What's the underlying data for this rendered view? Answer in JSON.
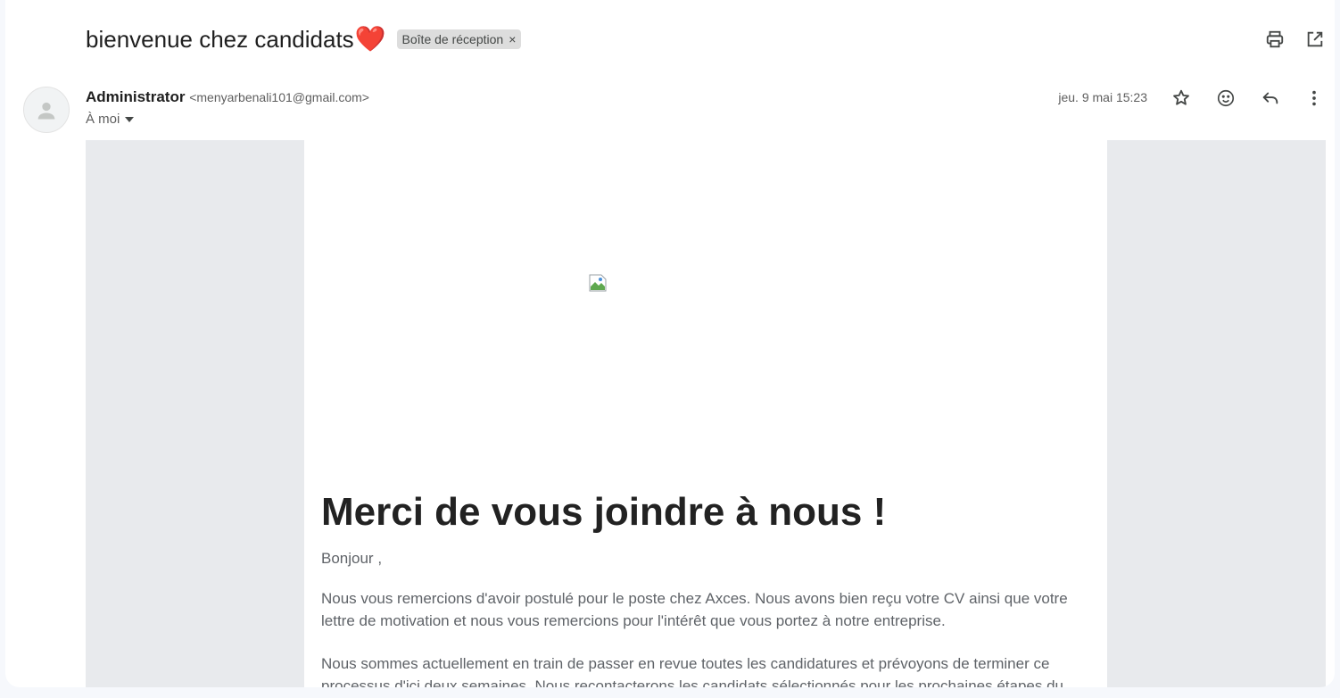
{
  "email": {
    "subject": "bienvenue chez candidats",
    "subject_emoji": "❤️",
    "label": "Boîte de réception",
    "label_close": "×",
    "sender_name": "Administrator",
    "sender_email": "<menyarbenali101@gmail.com>",
    "recipient": "À moi",
    "date": "jeu. 9 mai 15:23"
  },
  "icons": {
    "print": "print-icon",
    "open_new_window": "open-in-new-icon",
    "star": "star-icon",
    "emoji": "emoji-reaction-icon",
    "reply": "reply-icon",
    "more": "more-vert-icon",
    "avatar": "person-icon",
    "broken_image": "broken-image-icon"
  },
  "body": {
    "headline": "Merci de vous joindre à nous !",
    "greeting": "Bonjour ,",
    "paragraph1": "Nous vous remercions d'avoir postulé pour le poste  chez Axces. Nous avons bien reçu votre CV ainsi que votre lettre de motivation et nous vous remercions pour l'intérêt que vous portez à notre entreprise.",
    "paragraph2": "Nous sommes actuellement en train de passer en revue toutes les candidatures et prévoyons de terminer ce processus d'ici deux semaines. Nous recontacterons les candidats sélectionnés pour les prochaines étapes du"
  }
}
